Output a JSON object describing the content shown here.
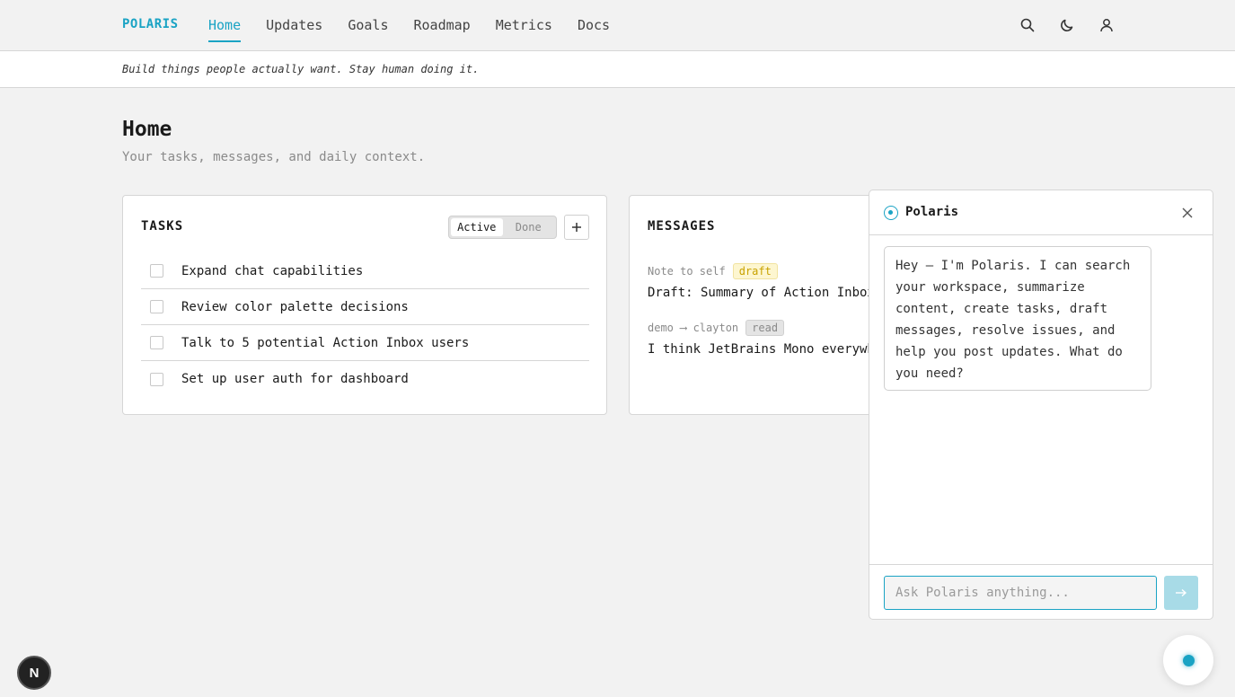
{
  "brand": "POLARIS",
  "nav": [
    "Home",
    "Updates",
    "Goals",
    "Roadmap",
    "Metrics",
    "Docs"
  ],
  "nav_active": "Home",
  "nav_icons": [
    "search-icon",
    "moon-icon",
    "user-icon"
  ],
  "tagline": "Build things people actually want. Stay human doing it.",
  "page": {
    "title": "Home",
    "subtitle": "Your tasks, messages, and daily context."
  },
  "tasks": {
    "title": "TASKS",
    "filter_active": "Active",
    "filter_done": "Done",
    "items": [
      "Expand chat capabilities",
      "Review color palette decisions",
      "Talk to 5 potential Action Inbox users",
      "Set up user auth for dashboard"
    ]
  },
  "messages": {
    "title": "MESSAGES",
    "items": [
      {
        "meta": "Note to self",
        "badge": "draft",
        "body": "Draft: Summary of Action Inbox"
      },
      {
        "meta": "demo ⟶ clayton",
        "badge": "read",
        "body": "I think JetBrains Mono everywh"
      }
    ]
  },
  "chat": {
    "title": "Polaris",
    "greeting": "Hey — I'm Polaris. I can search\nyour workspace, summarize\ncontent, create tasks, draft\nmessages, resolve issues, and\nhelp you post updates. What do\nyou need?",
    "input_placeholder": "Ask Polaris anything..."
  },
  "next_badge": "N",
  "colors": {
    "accent": "#1aa3c4",
    "background": "#f2f2f2",
    "draft_badge": "#fdf6d0"
  }
}
